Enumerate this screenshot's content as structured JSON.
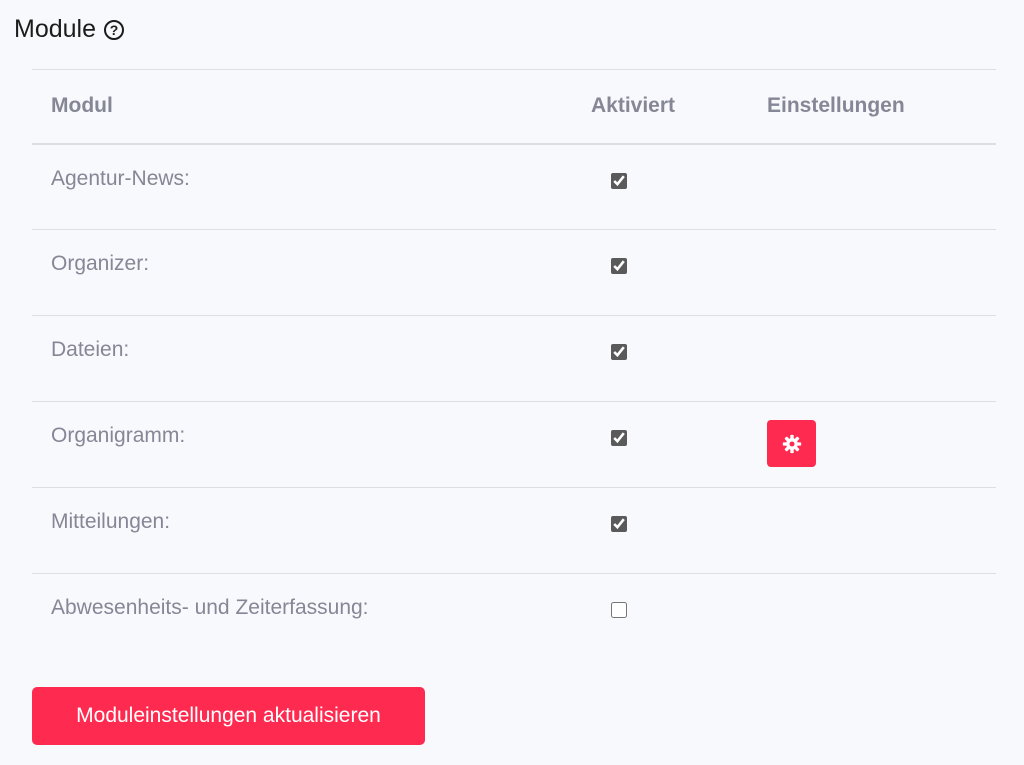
{
  "section": {
    "title": "Module",
    "help_icon": "question-circle-icon"
  },
  "table": {
    "headers": {
      "module": "Modul",
      "active": "Aktiviert",
      "settings": "Einstellungen"
    },
    "rows": [
      {
        "label": "Agentur-News:",
        "active": true,
        "has_settings": false
      },
      {
        "label": "Organizer:",
        "active": true,
        "has_settings": false
      },
      {
        "label": "Dateien:",
        "active": true,
        "has_settings": false
      },
      {
        "label": "Organigramm:",
        "active": true,
        "has_settings": true
      },
      {
        "label": "Mitteilungen:",
        "active": true,
        "has_settings": false
      },
      {
        "label": "Abwesenheits- und Zeiterfassung:",
        "active": false,
        "has_settings": false
      }
    ]
  },
  "settings_icon": "gear-icon",
  "submit_label": "Moduleinstellungen aktualisieren",
  "colors": {
    "accent": "#ff2a4f",
    "text_muted": "#858796",
    "background": "#f8f9fc"
  }
}
